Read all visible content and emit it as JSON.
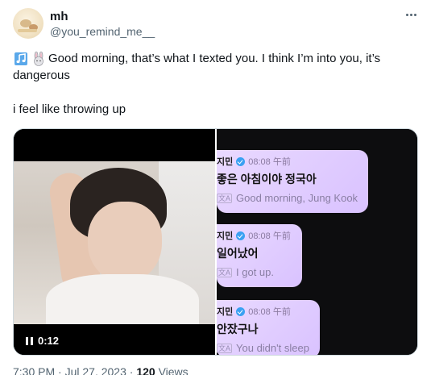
{
  "user": {
    "display_name": "mh",
    "handle": "@you_remind_me__"
  },
  "tweet": {
    "line1": "Good morning, that’s what I texted you. I think I’m into you, it’s",
    "line2": "dangerous",
    "line3": "i feel like throwing up",
    "emoji": [
      "music-note-icon",
      "rabbit-icon"
    ]
  },
  "video": {
    "elapsed": "0:12"
  },
  "chat": {
    "messages": [
      {
        "sender": "지민",
        "time": "08:08 午前",
        "text": "좋은 아침이야 정국아",
        "translation": "Good morning, Jung Kook"
      },
      {
        "sender": "지민",
        "time": "08:08 午前",
        "text": "일어났어",
        "translation": "I got up."
      },
      {
        "sender": "지민",
        "time": "08:08 午前",
        "text": "안잤구나",
        "translation": "You didn't sleep"
      }
    ],
    "translate_glyph": "文A"
  },
  "footer": {
    "timestamp": "7:30 PM · Jul 27, 2023 ·",
    "views_count": "120",
    "views_label": "Views"
  },
  "colors": {
    "bubble": "#dcc6ff",
    "verified": "#3aa1f2",
    "secondary_text": "#536471"
  }
}
